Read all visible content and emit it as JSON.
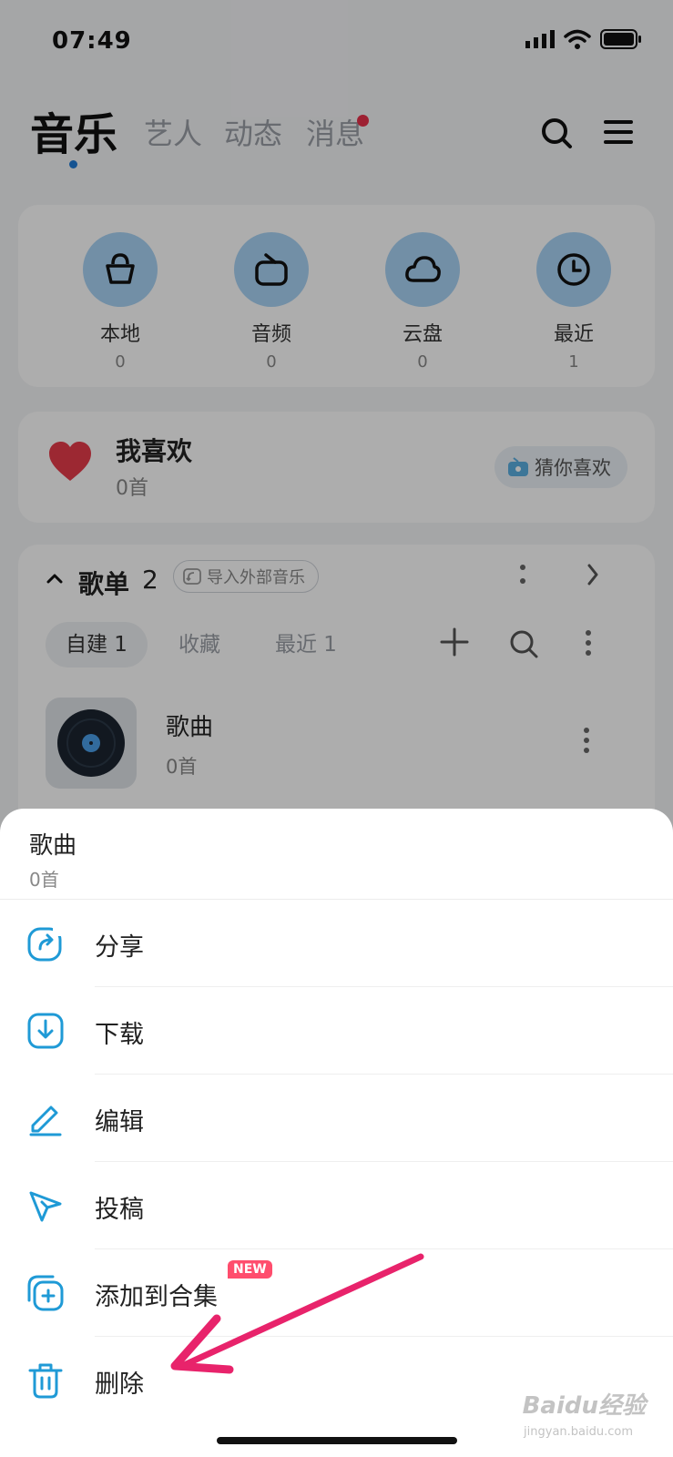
{
  "status_bar": {
    "time": "07:49"
  },
  "header": {
    "tabs": [
      {
        "label": "音乐"
      },
      {
        "label": "艺人"
      },
      {
        "label": "动态"
      },
      {
        "label": "消息"
      }
    ]
  },
  "quick_access": [
    {
      "label": "本地",
      "count": "0",
      "icon": "bag-icon"
    },
    {
      "label": "音频",
      "count": "0",
      "icon": "radio-icon"
    },
    {
      "label": "云盘",
      "count": "0",
      "icon": "cloud-icon"
    },
    {
      "label": "最近",
      "count": "1",
      "icon": "clock-icon"
    }
  ],
  "favorites": {
    "title": "我喜欢",
    "count": "0首",
    "guess_label": "猜你喜欢"
  },
  "playlist": {
    "title": "歌单",
    "count": "2",
    "import_label": "导入外部音乐",
    "subtabs": [
      {
        "label": "自建 1"
      },
      {
        "label": "收藏"
      },
      {
        "label": "最近 1"
      }
    ],
    "item": {
      "name": "歌曲",
      "count": "0首"
    }
  },
  "sheet": {
    "title": "歌曲",
    "subtitle": "0首",
    "items": [
      {
        "label": "分享",
        "icon": "share-icon"
      },
      {
        "label": "下载",
        "icon": "download-icon"
      },
      {
        "label": "编辑",
        "icon": "pencil-icon"
      },
      {
        "label": "投稿",
        "icon": "send-icon"
      },
      {
        "label": "添加到合集",
        "icon": "add-collection-icon",
        "badge": "NEW"
      },
      {
        "label": "删除",
        "icon": "trash-icon"
      }
    ]
  },
  "watermark": {
    "brand": "Baidu经验",
    "url": "jingyan.baidu.com"
  },
  "colors": {
    "accent": "#1f9ad6",
    "badge": "#ff4d6d",
    "arrow": "#e8236b",
    "heart": "#e63b4a"
  }
}
